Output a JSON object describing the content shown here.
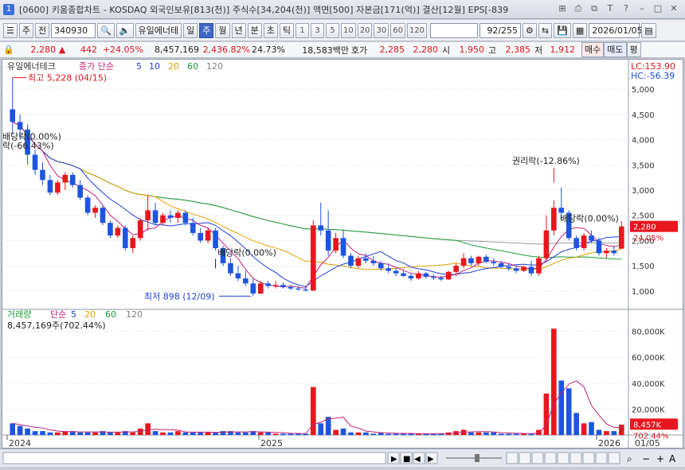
{
  "window": {
    "number": "1",
    "title": "[0600] 키움종합차트 - KOSDAQ 외국인보유[813(천)] 주식수[34,204(천)] 액면[500] 자본금[171(억)] 결산[12월] EPS[-839"
  },
  "toolbar": {
    "type1": "주",
    "type2": "전",
    "code": "340930",
    "stock_name": "유일에너테",
    "periods": [
      "일",
      "주",
      "월",
      "년",
      "분",
      "초",
      "틱"
    ],
    "selected_period": "주",
    "intervals": [
      "1",
      "3",
      "5",
      "10",
      "20",
      "30",
      "60",
      "120"
    ],
    "count": "92/255",
    "date": "2026/01/05"
  },
  "info": {
    "price": "2,280",
    "change": "442",
    "change_pct": "+24.05%",
    "volume": "8,457,169",
    "vol_pct": "2,436.82%",
    "turnover": "24.73%",
    "amount": "18,583백만",
    "ask_label": "호가",
    "ask": "2,285",
    "bid": "2,280",
    "open_label": "시",
    "open": "1,950",
    "high_label": "고",
    "high": "2,385",
    "low_label": "저",
    "low": "1,912",
    "buy": "매수",
    "sell": "매도",
    "eval": "평"
  },
  "chart_data": {
    "type": "candlestick",
    "title": "유일에너테크",
    "legend": [
      {
        "name": "종가 단순",
        "color": "#c0227a"
      },
      {
        "name": "5",
        "color": "#1f3fd8"
      },
      {
        "name": "10",
        "color": "#1f3fd8"
      },
      {
        "name": "20",
        "color": "#e0a000"
      },
      {
        "name": "60",
        "color": "#1e9a3a"
      },
      {
        "name": "120",
        "color": "#808080"
      }
    ],
    "lc": "LC:153.90",
    "hc": "HC:-56.39",
    "price_axis": [
      "5,000",
      "4,500",
      "4,000",
      "3,500",
      "3,000",
      "2,500",
      "2,000",
      "1,500",
      "1,000"
    ],
    "ylim": [
      700,
      5300
    ],
    "current_price": "2,280",
    "current_pct": "24.05%",
    "annotations": {
      "high": "최고 5,228 (04/15)",
      "low": "최저 898 (12/09)",
      "rights": "권리락(-12.86%)",
      "div1": "배당락(0.00%)",
      "div2": "배당락(0.00%)",
      "left1": "배당락(0.00%)",
      "left2": "락(-66.43%)"
    },
    "ohlc": [
      [
        4600,
        5228,
        4100,
        4350
      ],
      [
        4350,
        4500,
        4000,
        4200
      ],
      [
        4200,
        4300,
        3500,
        3700
      ],
      [
        3700,
        3800,
        3300,
        3400
      ],
      [
        3400,
        3550,
        3100,
        3200
      ],
      [
        3200,
        3300,
        2900,
        2950
      ],
      [
        2950,
        3200,
        2900,
        3150
      ],
      [
        3150,
        3350,
        3000,
        3300
      ],
      [
        3300,
        3350,
        3050,
        3100
      ],
      [
        3100,
        3200,
        2800,
        2850
      ],
      [
        2850,
        2900,
        2500,
        2550
      ],
      [
        2550,
        2700,
        2450,
        2650
      ],
      [
        2650,
        2700,
        2300,
        2350
      ],
      [
        2350,
        2400,
        2050,
        2100
      ],
      [
        2100,
        2300,
        2050,
        2250
      ],
      [
        2250,
        2300,
        1800,
        1850
      ],
      [
        1850,
        2100,
        1750,
        2050
      ],
      [
        2050,
        2450,
        2000,
        2400
      ],
      [
        2400,
        2900,
        2200,
        2600
      ],
      [
        2600,
        2750,
        2300,
        2350
      ],
      [
        2350,
        2550,
        2300,
        2500
      ],
      [
        2500,
        2600,
        2350,
        2450
      ],
      [
        2450,
        2600,
        2350,
        2550
      ],
      [
        2550,
        2600,
        2300,
        2350
      ],
      [
        2350,
        2450,
        2100,
        2150
      ],
      [
        2150,
        2250,
        1950,
        2000
      ],
      [
        2000,
        2250,
        1950,
        2200
      ],
      [
        2200,
        2250,
        1800,
        1850
      ],
      [
        1850,
        1900,
        1500,
        1550
      ],
      [
        1550,
        1650,
        1300,
        1350
      ],
      [
        1350,
        1500,
        1200,
        1250
      ],
      [
        1250,
        1400,
        1100,
        1150
      ],
      [
        1150,
        1250,
        898,
        950
      ],
      [
        950,
        1200,
        940,
        1150
      ],
      [
        1150,
        1200,
        1050,
        1100
      ],
      [
        1100,
        1200,
        1050,
        1120
      ],
      [
        1120,
        1170,
        1050,
        1080
      ],
      [
        1080,
        1120,
        1020,
        1050
      ],
      [
        1050,
        1100,
        1010,
        1030
      ],
      [
        1030,
        1080,
        990,
        1010
      ],
      [
        1010,
        2400,
        1000,
        2300
      ],
      [
        2300,
        2750,
        2100,
        2200
      ],
      [
        2200,
        2600,
        1700,
        1800
      ],
      [
        1800,
        2150,
        1750,
        2050
      ],
      [
        2050,
        2200,
        1650,
        1700
      ],
      [
        1700,
        1750,
        1450,
        1500
      ],
      [
        1500,
        1700,
        1450,
        1650
      ],
      [
        1650,
        1750,
        1550,
        1600
      ],
      [
        1600,
        1700,
        1500,
        1550
      ],
      [
        1550,
        1600,
        1400,
        1450
      ],
      [
        1450,
        1550,
        1350,
        1400
      ],
      [
        1400,
        1450,
        1300,
        1350
      ],
      [
        1350,
        1400,
        1280,
        1300
      ],
      [
        1300,
        1350,
        1200,
        1250
      ],
      [
        1250,
        1400,
        1230,
        1350
      ],
      [
        1350,
        1380,
        1250,
        1280
      ],
      [
        1280,
        1330,
        1220,
        1260
      ],
      [
        1260,
        1300,
        1200,
        1230
      ],
      [
        1230,
        1400,
        1220,
        1380
      ],
      [
        1380,
        1550,
        1300,
        1500
      ],
      [
        1500,
        1750,
        1450,
        1650
      ],
      [
        1650,
        1700,
        1500,
        1550
      ],
      [
        1550,
        1700,
        1500,
        1680
      ],
      [
        1680,
        1720,
        1550,
        1580
      ],
      [
        1580,
        1650,
        1500,
        1550
      ],
      [
        1550,
        1600,
        1450,
        1480
      ],
      [
        1480,
        1550,
        1400,
        1450
      ],
      [
        1450,
        1500,
        1350,
        1400
      ],
      [
        1400,
        1500,
        1380,
        1480
      ],
      [
        1480,
        1600,
        1300,
        1350
      ],
      [
        1350,
        1700,
        1300,
        1650
      ],
      [
        1650,
        2500,
        1600,
        2200
      ],
      [
        2200,
        2800,
        2100,
        2650
      ],
      [
        2650,
        3050,
        2400,
        2550
      ],
      [
        2550,
        2600,
        2000,
        2050
      ],
      [
        2050,
        2100,
        1800,
        1850
      ],
      [
        1850,
        2150,
        1800,
        2100
      ],
      [
        2100,
        2200,
        1950,
        2000
      ],
      [
        2000,
        2050,
        1700,
        1750
      ],
      [
        1750,
        1850,
        1650,
        1800
      ],
      [
        1800,
        1900,
        1700,
        1750
      ],
      [
        1838,
        2385,
        1912,
        2280
      ]
    ],
    "volume_axis": [
      "80,000K",
      "60,000K",
      "40,000K",
      "20,000K"
    ],
    "volume_label": "거래량",
    "volume_legend": [
      "단순",
      "5",
      "20",
      "60",
      "120"
    ],
    "volume_now": "8,457,169주(702.44%)",
    "volume_tag": "8,457K",
    "volume_pct_tag": "702.44%",
    "volumes": [
      9,
      7,
      5,
      3,
      3,
      2,
      2,
      3,
      3,
      2,
      2,
      2,
      3,
      2,
      2,
      3,
      2,
      5,
      9,
      3,
      2,
      2,
      3,
      2,
      2,
      2,
      2,
      2,
      3,
      3,
      2,
      2,
      3,
      2,
      2,
      1,
      1,
      1,
      1,
      1,
      37,
      9,
      14,
      4,
      5,
      2,
      2,
      2,
      1,
      2,
      1,
      1,
      1,
      1,
      1,
      1,
      1,
      1,
      2,
      3,
      4,
      2,
      2,
      2,
      2,
      1,
      1,
      1,
      1,
      1,
      4,
      32,
      82,
      42,
      36,
      17,
      9,
      10,
      4,
      3,
      3,
      8
    ],
    "x_labels": [
      "2024",
      "2025",
      "2026",
      "01/05"
    ]
  },
  "bottom": {}
}
